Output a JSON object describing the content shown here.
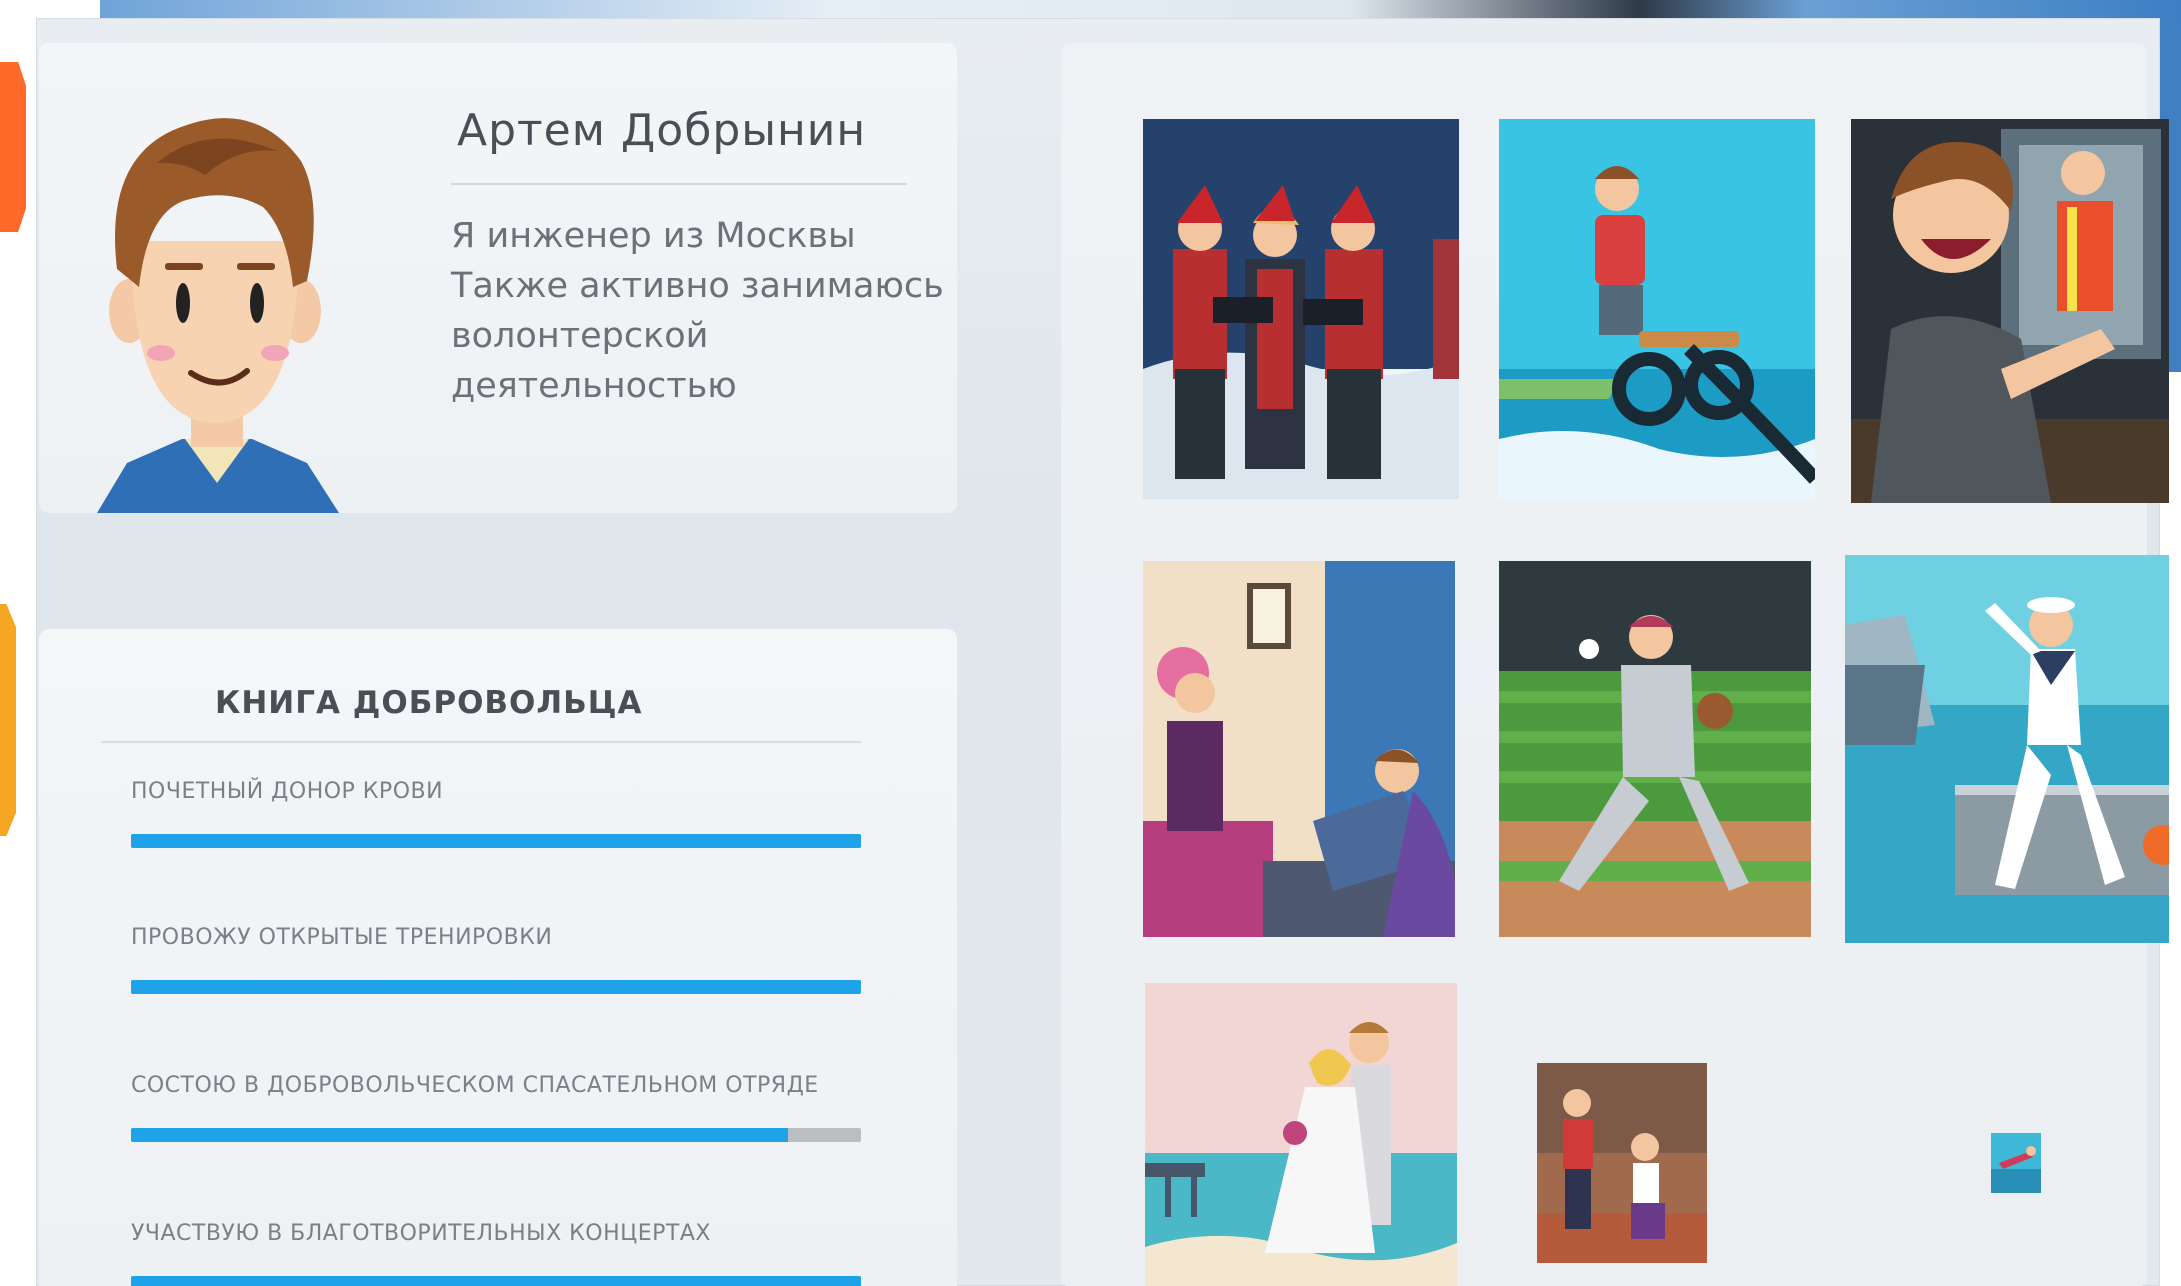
{
  "profile": {
    "name": "Артем Добрынин",
    "bio": [
      "Я инженер из Москвы",
      "Также активно занимаюсь",
      "волонтерской деятельностью"
    ]
  },
  "volunteer_book": {
    "title": "КНИГА ДОБРОВОЛЬЦА",
    "skills": [
      {
        "label": "Почетный донор крови",
        "progress": 1.0
      },
      {
        "label": "Провожу открытые тренировки",
        "progress": 1.0
      },
      {
        "label": "Состою в добровольческом спасательном отряде",
        "progress": 0.9
      },
      {
        "label": "Участвую в благотворительных концертах",
        "progress": 1.0
      }
    ]
  },
  "gallery": {
    "tiles": [
      {
        "icon": "carolers-illustration"
      },
      {
        "icon": "flyboard-illustration"
      },
      {
        "icon": "car-window-illustration"
      },
      {
        "icon": "therapy-session-illustration"
      },
      {
        "icon": "baseball-pitcher-illustration"
      },
      {
        "icon": "sailor-illustration"
      },
      {
        "icon": "wedding-beach-illustration"
      },
      {
        "icon": "athletes-illustration"
      },
      {
        "icon": "diver-thumbnail"
      }
    ]
  },
  "colors": {
    "progress_fill": "#1ea3e8",
    "progress_track": "#b9bec3",
    "accent_orange": "#ff6a2b",
    "accent_yellow": "#f5a623"
  }
}
